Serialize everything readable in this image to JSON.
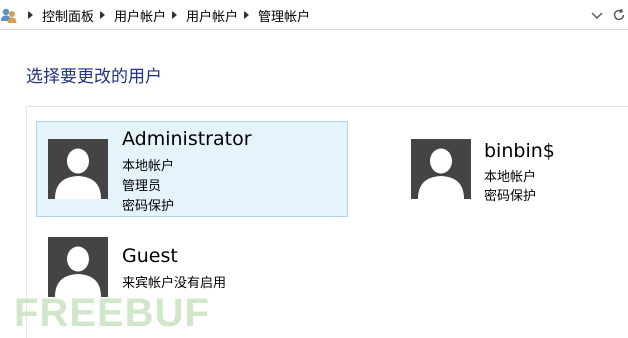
{
  "address_bar": {
    "icon": "user-accounts-icon",
    "breadcrumbs": [
      "控制面板",
      "用户帐户",
      "用户帐户",
      "管理帐户"
    ]
  },
  "page": {
    "title": "选择要更改的用户"
  },
  "accounts": [
    {
      "name": "Administrator",
      "lines": [
        "本地帐户",
        "管理员",
        "密码保护"
      ],
      "selected": true
    },
    {
      "name": "binbin$",
      "lines": [
        "本地帐户",
        "密码保护"
      ],
      "selected": false
    },
    {
      "name": "Guest",
      "lines": [
        "来宾帐户没有启用"
      ],
      "selected": false
    }
  ],
  "watermark": {
    "text": "FREEBUF",
    "color": "#c9e3c0"
  },
  "colors": {
    "title": "#1e3287",
    "selection_bg": "#e5f3fb",
    "selection_border": "#a9d4ef",
    "avatar_bg": "#444444"
  }
}
